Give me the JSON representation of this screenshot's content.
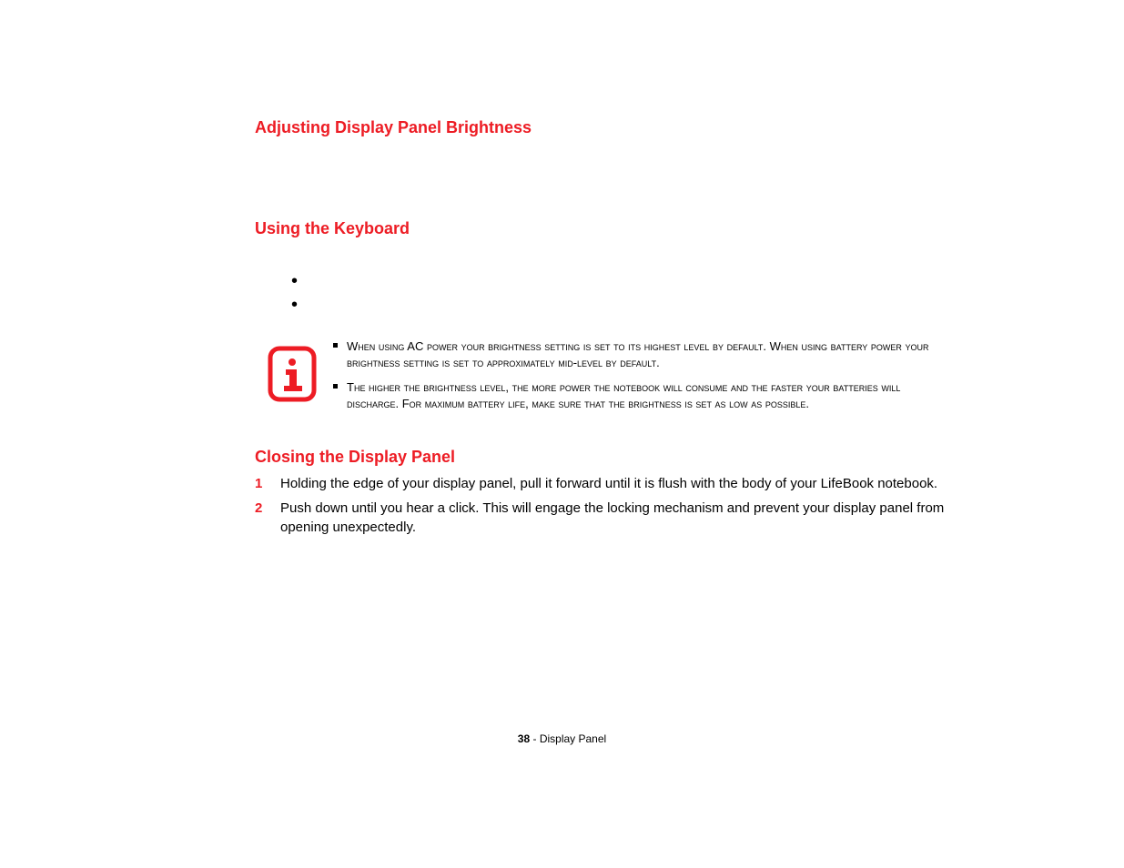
{
  "headings": {
    "adjusting": "Adjusting Display Panel Brightness",
    "keyboard": "Using the Keyboard",
    "closing": "Closing the Display Panel"
  },
  "info_notes": {
    "note1": "When using AC power your brightness setting is set to its highest level by default. When using battery power your brightness setting is set to approximately mid-level by default.",
    "note2": "The higher the brightness level, the more power the notebook will consume and the faster your batteries will discharge. For maximum battery life, make sure that the brightness is set as low as possible."
  },
  "closing_steps": {
    "step1_num": "1",
    "step1_text": "Holding the edge of your display panel, pull it forward until it is flush with the body of your LifeBook notebook.",
    "step2_num": "2",
    "step2_text": "Push down until you hear a click. This will engage the locking mechanism and prevent your display panel from opening unexpectedly."
  },
  "footer": {
    "page_number": "38",
    "separator": " - ",
    "section_name": "Display Panel"
  }
}
